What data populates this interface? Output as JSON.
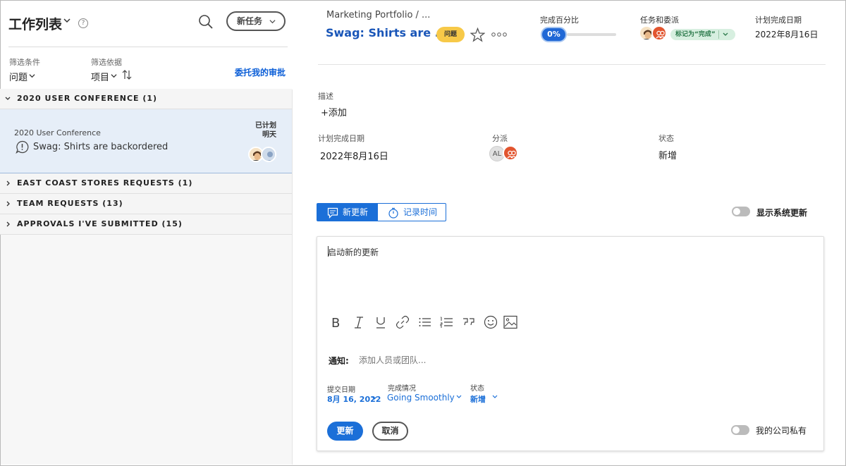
{
  "left_panel": {
    "title": "工作列表",
    "help_glyph": "?",
    "new_task_label": "新任务",
    "filter_label": "筛选条件",
    "filter_value": "问题",
    "group_by_label": "筛选依据",
    "group_by_value": "项目",
    "delegate_link": "委托我的审批",
    "groups": [
      {
        "label": "2020 USER CONFERENCE (1)",
        "expanded": true
      },
      {
        "label": "EAST COAST STORES  REQUESTS (1)",
        "expanded": false
      },
      {
        "label": "TEAM REQUESTS (13)",
        "expanded": false
      },
      {
        "label": "APPROVALS I'VE SUBMITTED (15)",
        "expanded": false
      }
    ],
    "item": {
      "project": "2020 User Conference",
      "title": "Swag: Shirts are backordered",
      "status_line1": "已计划",
      "status_line2": "明天"
    }
  },
  "header": {
    "breadcrumb": "Marketing Portfolio  /  ...",
    "title": "Swag: Shirts are ...",
    "issue_badge": "问题",
    "percent_label": "完成百分比",
    "percent_value": "0%",
    "percent_complete": 0,
    "assign_label": "任务和委派",
    "mark_done_label": "标记为“完成”",
    "planned_date_label": "计划完成日期",
    "planned_date_value": "2022年8月16日"
  },
  "details": {
    "description_label": "描述",
    "add_label": "+添加",
    "planned_date_label": "计划完成日期",
    "planned_date_value": "2022年8月16日",
    "assign_label": "分派",
    "assign_initials": "AL",
    "status_label": "状态",
    "status_value": "新增"
  },
  "updates": {
    "tab_new": "新更新",
    "tab_log": "记录时间",
    "show_system_label": "显示系统更新",
    "editor_placeholder": "启动新的更新",
    "notify_label": "通知:",
    "notify_placeholder": "添加人员或团队...",
    "submit_date_label": "提交日期",
    "submit_date_value": "8月 16, 2022",
    "condition_label": "完成情况",
    "condition_value": "Going Smoothly",
    "status_label": "状态",
    "status_value": "新增",
    "update_button": "更新",
    "cancel_button": "取消",
    "private_label": "我的公司私有"
  }
}
